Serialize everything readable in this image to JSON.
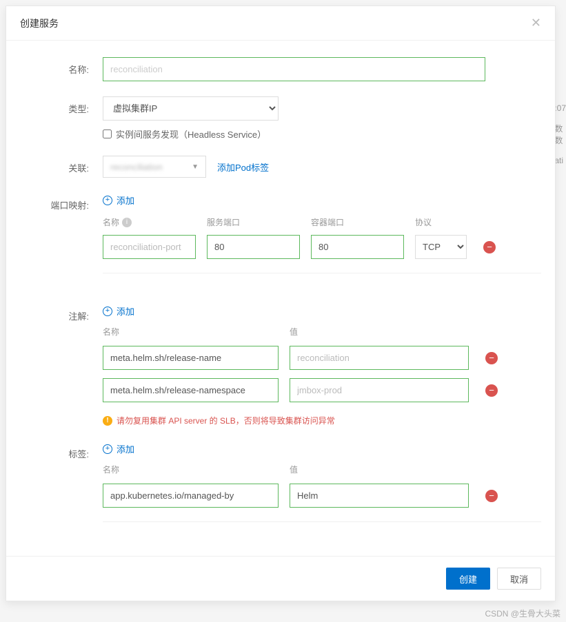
{
  "modal": {
    "title": "创建服务",
    "form": {
      "name_label": "名称:",
      "name_value": "reconciliation",
      "type_label": "类型:",
      "type_value": "虚拟集群IP",
      "headless_label": "实例间服务发现（Headless Service）",
      "relation_label": "关联:",
      "relation_value": "reconciliation",
      "add_pod_label": "添加Pod标签",
      "port_label": "端口映射:",
      "add_label": "添加",
      "port_table": {
        "header_name": "名称",
        "header_service_port": "服务端口",
        "header_container_port": "容器端口",
        "header_protocol": "协议",
        "rows": [
          {
            "name": "reconciliation-port",
            "service_port": "80",
            "container_port": "80",
            "protocol": "TCP"
          }
        ]
      },
      "annotation_label": "注解:",
      "kv_header_name": "名称",
      "kv_header_value": "值",
      "annotations": [
        {
          "name": "meta.helm.sh/release-name",
          "value": "reconciliation"
        },
        {
          "name": "meta.helm.sh/release-namespace",
          "value": "jmbox-prod"
        }
      ],
      "warning_text": "请勿复用集群 API server 的 SLB，否则将导致集群访问异常",
      "tags_label": "标签:",
      "tags": [
        {
          "name": "app.kubernetes.io/managed-by",
          "value": "Helm"
        }
      ]
    },
    "footer": {
      "confirm": "创建",
      "cancel": "取消"
    }
  },
  "watermark": "CSDN @生骨大头菜"
}
